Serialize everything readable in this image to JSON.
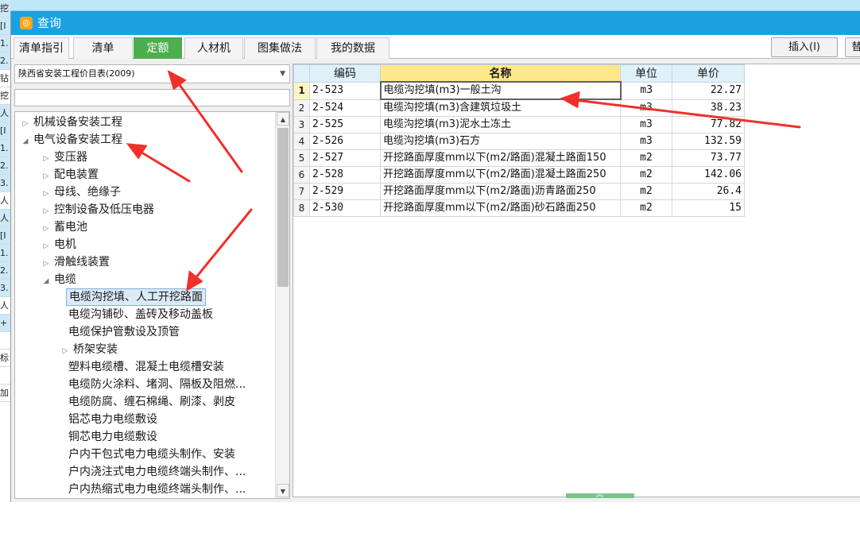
{
  "background": {
    "left_fragments": [
      "挖",
      "[I",
      "1.",
      "2.",
      "钻",
      "挖",
      "人",
      "[I",
      "1.",
      "2.",
      "3.",
      "人",
      "人",
      "[I",
      "1.",
      "2.",
      "3.",
      "人",
      "+",
      "",
      "标",
      "",
      "",
      "加"
    ]
  },
  "window": {
    "title": "查询",
    "icon": "app-logo-icon"
  },
  "tabs": [
    {
      "label": "清单指引"
    },
    {
      "label": "清单"
    },
    {
      "label": "定额"
    },
    {
      "label": "人材机"
    },
    {
      "label": "图集做法"
    },
    {
      "label": "我的数据"
    }
  ],
  "toolbar": {
    "insert_label": "插入(I)",
    "replace_label": "替"
  },
  "library": {
    "selected": "陕西省安装工程价目表(2009)"
  },
  "search": {
    "value": "",
    "placeholder": ""
  },
  "tree": {
    "items": [
      {
        "label": "机械设备安装工程",
        "toggle": "▷"
      },
      {
        "label": "电气设备安装工程",
        "toggle": "◢"
      },
      {
        "label": "变压器",
        "toggle": "▷"
      },
      {
        "label": "配电装置",
        "toggle": "▷"
      },
      {
        "label": "母线、绝缘子",
        "toggle": "▷"
      },
      {
        "label": "控制设备及低压电器",
        "toggle": "▷"
      },
      {
        "label": "蓄电池",
        "toggle": "▷"
      },
      {
        "label": "电机",
        "toggle": "▷"
      },
      {
        "label": "滑触线装置",
        "toggle": "▷"
      },
      {
        "label": "电缆",
        "toggle": "◢"
      },
      {
        "label": "电缆沟挖填、人工开挖路面",
        "toggle": ""
      },
      {
        "label": "电缆沟铺砂、盖砖及移动盖板",
        "toggle": ""
      },
      {
        "label": "电缆保护管敷设及顶管",
        "toggle": ""
      },
      {
        "label": "桥架安装",
        "toggle": "▷"
      },
      {
        "label": "塑料电缆槽、混凝土电缆槽安装",
        "toggle": ""
      },
      {
        "label": "电缆防火涂料、堵洞、隔板及阻燃...",
        "toggle": ""
      },
      {
        "label": "电缆防腐、缠石棉绳、刷漆、剥皮",
        "toggle": ""
      },
      {
        "label": "铝芯电力电缆敷设",
        "toggle": ""
      },
      {
        "label": "铜芯电力电缆敷设",
        "toggle": ""
      },
      {
        "label": "户内干包式电力电缆头制作、安装",
        "toggle": ""
      },
      {
        "label": "户内浇注式电力电缆终端头制作、...",
        "toggle": ""
      },
      {
        "label": "户内热缩式电力电缆终端头制作、...",
        "toggle": ""
      }
    ]
  },
  "table": {
    "columns": [
      "编码",
      "名称",
      "单位",
      "单价"
    ],
    "rows": [
      {
        "idx": "1",
        "code": "2-523",
        "name": "电缆沟挖填(m3)一般土沟",
        "unit": "m3",
        "price": "22.27"
      },
      {
        "idx": "2",
        "code": "2-524",
        "name": "电缆沟挖填(m3)含建筑垃圾土",
        "unit": "m3",
        "price": "38.23"
      },
      {
        "idx": "3",
        "code": "2-525",
        "name": "电缆沟挖填(m3)泥水土冻土",
        "unit": "m3",
        "price": "77.82"
      },
      {
        "idx": "4",
        "code": "2-526",
        "name": "电缆沟挖填(m3)石方",
        "unit": "m3",
        "price": "132.59"
      },
      {
        "idx": "5",
        "code": "2-527",
        "name": "开挖路面厚度mm以下(m2/路面)混凝土路面150",
        "unit": "m2",
        "price": "73.77"
      },
      {
        "idx": "6",
        "code": "2-528",
        "name": "开挖路面厚度mm以下(m2/路面)混凝土路面250",
        "unit": "m2",
        "price": "142.06"
      },
      {
        "idx": "7",
        "code": "2-529",
        "name": "开挖路面厚度mm以下(m2/路面)沥青路面250",
        "unit": "m2",
        "price": "26.4"
      },
      {
        "idx": "8",
        "code": "2-530",
        "name": "开挖路面厚度mm以下(m2/路面)砂石路面250",
        "unit": "m2",
        "price": "15"
      }
    ]
  },
  "colors": {
    "title_bar": "#1ba1e2",
    "active_tab": "#4cae4c",
    "name_header": "#ffe88a",
    "annotation_arrow": "#f0302a"
  }
}
